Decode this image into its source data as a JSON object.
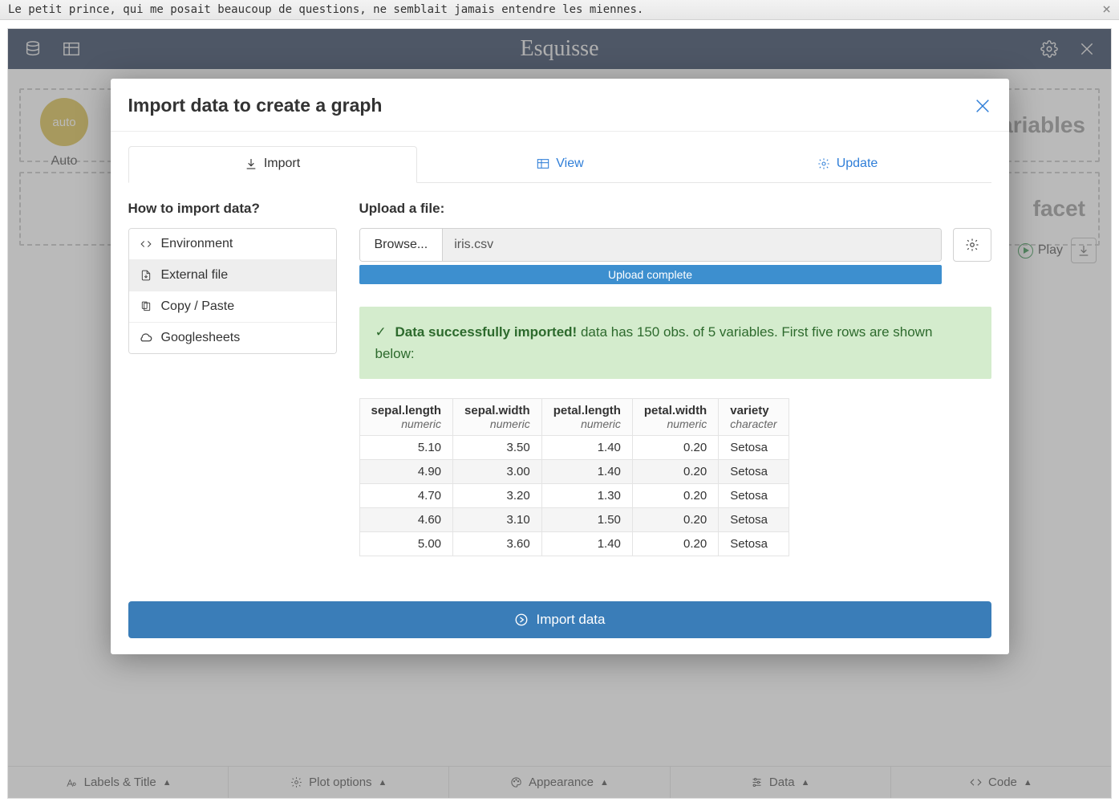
{
  "window": {
    "title": "Le petit prince, qui me posait beaucoup de questions, ne semblait jamais entendre les miennes."
  },
  "app": {
    "brand": "Esquisse"
  },
  "canvas": {
    "chip_label_inner": "auto",
    "chip_label_outer": "Auto",
    "dropzones": [
      "Variables",
      "facet"
    ],
    "play_label": "Play"
  },
  "bottombar": [
    "Labels & Title",
    "Plot options",
    "Appearance",
    "Data",
    "Code"
  ],
  "modal": {
    "title": "Import data to create a graph",
    "tabs": {
      "import": "Import",
      "view": "View",
      "update": "Update"
    },
    "left": {
      "heading": "How to import data?",
      "items": {
        "environment": "Environment",
        "external": "External file",
        "copypaste": "Copy / Paste",
        "gsheets": "Googlesheets"
      }
    },
    "right": {
      "heading": "Upload a file:",
      "browse": "Browse...",
      "filename": "iris.csv",
      "progress": "Upload complete",
      "alert_strong": "Data successfully imported!",
      "alert_rest": " data has 150 obs. of 5 variables. First five rows are shown below:"
    },
    "preview": {
      "columns": [
        {
          "name": "sepal.length",
          "type": "numeric",
          "align": "num"
        },
        {
          "name": "sepal.width",
          "type": "numeric",
          "align": "num"
        },
        {
          "name": "petal.length",
          "type": "numeric",
          "align": "num"
        },
        {
          "name": "petal.width",
          "type": "numeric",
          "align": "num"
        },
        {
          "name": "variety",
          "type": "character",
          "align": "txt"
        }
      ],
      "rows": [
        [
          "5.10",
          "3.50",
          "1.40",
          "0.20",
          "Setosa"
        ],
        [
          "4.90",
          "3.00",
          "1.40",
          "0.20",
          "Setosa"
        ],
        [
          "4.70",
          "3.20",
          "1.30",
          "0.20",
          "Setosa"
        ],
        [
          "4.60",
          "3.10",
          "1.50",
          "0.20",
          "Setosa"
        ],
        [
          "5.00",
          "3.60",
          "1.40",
          "0.20",
          "Setosa"
        ]
      ]
    },
    "import_button": "Import data"
  }
}
